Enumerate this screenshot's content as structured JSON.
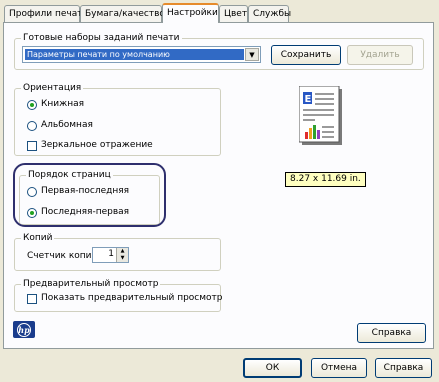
{
  "tabs": [
    {
      "label": "Профили печати"
    },
    {
      "label": "Бумага/качество"
    },
    {
      "label": "Настройки"
    },
    {
      "label": "Цвет"
    },
    {
      "label": "Службы"
    }
  ],
  "presets": {
    "title": "Готовые наборы заданий печати",
    "selected": "Параметры печати по умолчанию",
    "save_label": "Сохранить",
    "delete_label": "Удалить"
  },
  "orientation": {
    "title": "Ориентация",
    "portrait": "Книжная",
    "landscape": "Альбомная",
    "mirror": "Зеркальное отражение"
  },
  "page_order": {
    "title": "Порядок страниц",
    "first_to_last": "Первая-последняя",
    "last_to_first": "Последняя-первая"
  },
  "copies": {
    "title": "Копий",
    "counter_label": "Счетчик копий",
    "value": "1"
  },
  "preview": {
    "title": "Предварительный просмотр",
    "show_label": "Показать предварительный просмотр"
  },
  "paper_size": "8.27 x 11.69 in.",
  "logo_text": "hp",
  "help_label": "Справка",
  "dialog": {
    "ok_label": "ОК",
    "cancel_label": "Отмена",
    "help_label": "Справка"
  }
}
